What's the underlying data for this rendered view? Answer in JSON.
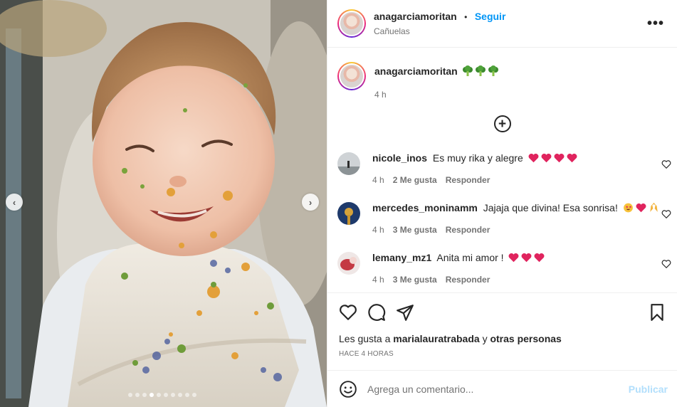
{
  "post": {
    "username": "anagarciamoritan",
    "separator": "•",
    "follow_label": "Seguir",
    "location": "Cañuelas",
    "more_label": "•••"
  },
  "caption": {
    "username": "anagarciamoritan",
    "emoji": "broccoli-emoji x3",
    "time": "4 h"
  },
  "carousel": {
    "dot_count": 10,
    "active_index": 3
  },
  "comments": [
    {
      "username": "nicole_inos",
      "text": "Es muy rika y alegre",
      "time": "4 h",
      "likes": "2 Me gusta",
      "reply": "Responder",
      "emoji": "red-heart x4"
    },
    {
      "username": "mercedes_moninamm",
      "text": "Jajaja que divina! Esa sonrisa!",
      "time": "4 h",
      "likes": "3 Me gusta",
      "reply": "Responder",
      "emoji": "star-struck, red-heart, raised-hands"
    },
    {
      "username": "lemany_mz1",
      "text": "Anita mi amor !",
      "time": "4 h",
      "likes": "3 Me gusta",
      "reply": "Responder",
      "emoji": "red-heart x3"
    }
  ],
  "likes_line": {
    "prefix": "Les gusta a",
    "user": "marialauratrabada",
    "joiner": "y",
    "others": "otras personas"
  },
  "timestamp": "HACE 4 HORAS",
  "composer": {
    "placeholder": "Agrega un comentario...",
    "publish_label": "Publicar"
  },
  "colors": {
    "accent": "#0095f6",
    "publish_disabled": "#b2dffc",
    "muted": "#737373",
    "heart": "#e0245e"
  }
}
